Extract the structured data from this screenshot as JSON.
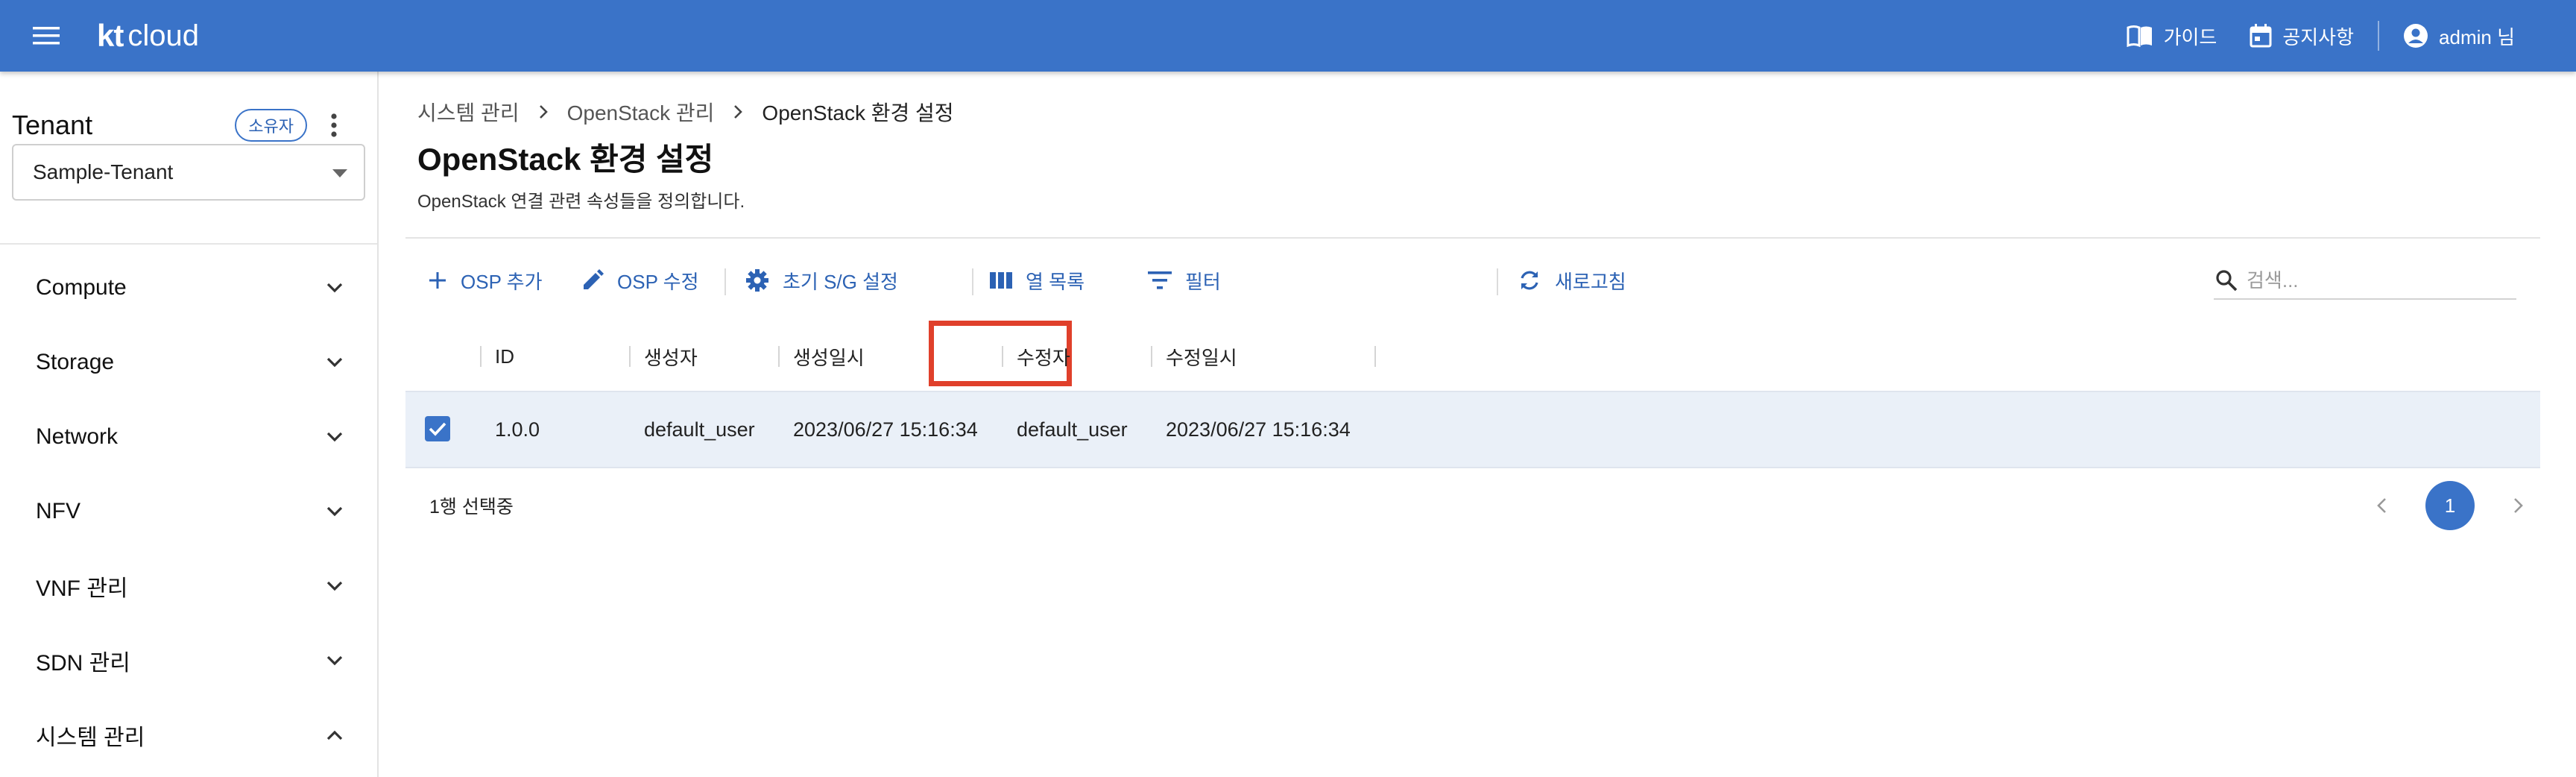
{
  "header": {
    "logo_kt": "kt",
    "logo_cloud": "cloud",
    "guide_label": "가이드",
    "notice_label": "공지사항",
    "user_label": "admin 님",
    "bar_color": "#3a73c8"
  },
  "sidebar": {
    "tenant_title": "Tenant",
    "owner_badge": "소유자",
    "tenant_selected": "Sample-Tenant",
    "items": [
      {
        "label": "Compute",
        "state": "collapsed"
      },
      {
        "label": "Storage",
        "state": "collapsed"
      },
      {
        "label": "Network",
        "state": "collapsed"
      },
      {
        "label": "NFV",
        "state": "collapsed"
      },
      {
        "label": "VNF 관리",
        "state": "collapsed"
      },
      {
        "label": "SDN 관리",
        "state": "collapsed"
      },
      {
        "label": "시스템 관리",
        "state": "expanded"
      }
    ]
  },
  "breadcrumb": [
    "시스템 관리",
    "OpenStack 관리",
    "OpenStack 환경 설정"
  ],
  "page": {
    "title": "OpenStack 환경 설정",
    "description": "OpenStack 연결 관련 속성들을 정의합니다."
  },
  "toolbar": {
    "add_label": "OSP 추가",
    "edit_label": "OSP 수정",
    "init_sg_label": "초기 S/G 설정",
    "columns_label": "열 목록",
    "filter_label": "필터",
    "refresh_label": "새로고침",
    "search_placeholder": "검색...",
    "highlight_color": "#e0402b"
  },
  "table": {
    "columns": [
      "ID",
      "생성자",
      "생성일시",
      "수정자",
      "수정일시"
    ],
    "rows": [
      {
        "checked": true,
        "id": "1.0.0",
        "creator": "default_user",
        "created": "2023/06/27 15:16:34",
        "modifier": "default_user",
        "modified": "2023/06/27 15:16:34"
      }
    ],
    "selected_text": "1행 선택중"
  },
  "pagination": {
    "current_page": "1"
  }
}
